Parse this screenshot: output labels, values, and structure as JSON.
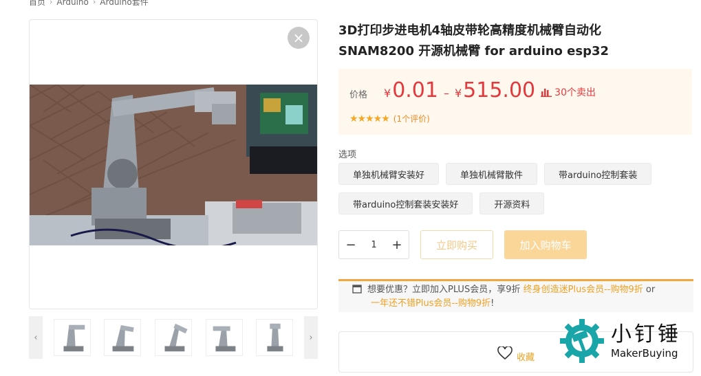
{
  "breadcrumb": {
    "home": "首页",
    "cat": "Arduino",
    "sub": "Arduino套件"
  },
  "product": {
    "title_line1": "3D打印步进电机4轴皮带轮高精度机械臂自动化",
    "title_line2": "SNAM8200 开源机械臂 for arduino esp32"
  },
  "price": {
    "label": "价格",
    "currency": "¥",
    "low": "0.01",
    "dash": "–",
    "high": "515.00",
    "sold": "30个卖出",
    "stars": "★★★★★",
    "reviews": "(1个评价)"
  },
  "options": {
    "label": "选项",
    "items": [
      "单独机械臂安装好",
      "单独机械臂散件",
      "带arduino控制套装",
      "带arduino控制套装安装好",
      "开源资料"
    ]
  },
  "quantity": {
    "value": "1",
    "minus": "−",
    "plus": "+"
  },
  "actions": {
    "buy_now": "立即购买",
    "add_cart": "加入购物车"
  },
  "promo": {
    "text": "想要优惠？立即加入PLUS会员，享9折",
    "link1": "终身创造迷Plus会员--购物9折",
    "or": " or",
    "link2": "一年还不错Plus会员--购物9折",
    "tail": "!"
  },
  "favorite": {
    "label": "收藏"
  },
  "logo": {
    "cn": "小钉锤",
    "en": "MakerBuying"
  },
  "gallery": {
    "close": "×",
    "prev": "‹",
    "next": "›",
    "thumbs": 5
  },
  "colors": {
    "price": "#e4393c",
    "accent": "#f0a020",
    "cart": "#fbd699",
    "promo_border": "#f3a43b",
    "logo_teal": "#1aa5a8"
  }
}
